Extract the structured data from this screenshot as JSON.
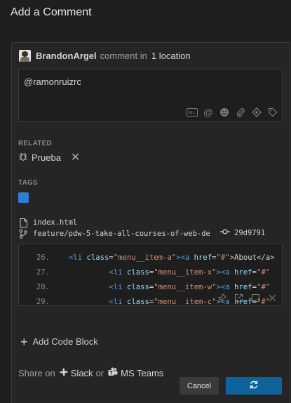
{
  "dialog": {
    "title": "Add a Comment"
  },
  "header": {
    "author": "BrandonArgel",
    "middle_text": "comment in",
    "location_text": "1 location"
  },
  "editor": {
    "text": "@ramonruizrc",
    "toolbar_icons": [
      "markdown-icon",
      "mention-icon",
      "emoji-icon",
      "attachment-icon",
      "codemark-icon",
      "tag-icon"
    ]
  },
  "related": {
    "label": "RELATED",
    "item": {
      "name": "Prueba",
      "icon": "bug-icon"
    }
  },
  "tags": {
    "label": "TAGS",
    "color": "#2f7cd3"
  },
  "file": {
    "name": "index.html",
    "branch": "feature/pdw-5-take-all-courses-of-web-de",
    "commit": "29d9791"
  },
  "code": {
    "lines": [
      {
        "num": "26.",
        "indent": "",
        "tag": "<li",
        "attr": "class",
        "val": "\"menu__item-a\"",
        "inner": "><a",
        "attr2": "href",
        "val2": "\"#\"",
        "text": ">About</a>"
      },
      {
        "num": "27.",
        "indent": "         ",
        "tag": "<li",
        "attr": "class",
        "val": "\"menu__item-x\"",
        "inner": "><a",
        "attr2": "href",
        "val2": "\"#\"",
        "text": ""
      },
      {
        "num": "28.",
        "indent": "         ",
        "tag": "<li",
        "attr": "class",
        "val": "\"menu__item-w\"",
        "inner": "><a",
        "attr2": "href",
        "val2": "\"#\"",
        "text": ""
      },
      {
        "num": "29.",
        "indent": "         ",
        "tag": "<li",
        "attr": "class",
        "val": "\"menu__item-c\"",
        "inner": "><a",
        "attr2": "href",
        "val2": "\"#\"",
        "text": ""
      }
    ]
  },
  "add_code_block": "Add Code Block",
  "share": {
    "prefix": "Share on",
    "slack": "Slack",
    "or": "or",
    "teams": "MS Teams"
  },
  "buttons": {
    "cancel": "Cancel",
    "submit_icon": "sync-icon"
  },
  "colors": {
    "accent": "#0e639c",
    "background": "#1f1f1f"
  }
}
